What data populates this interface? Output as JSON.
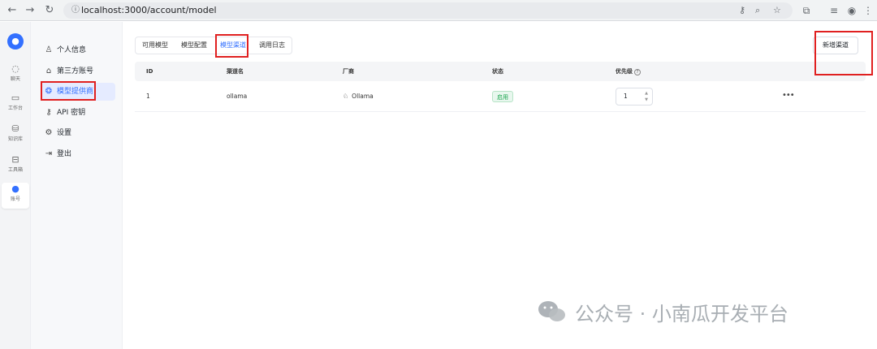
{
  "browser": {
    "url": "localhost:3000/account/model"
  },
  "rail": {
    "items": [
      {
        "icon": "chat-icon",
        "label": "聊天"
      },
      {
        "icon": "workbench-icon",
        "label": "工作台"
      },
      {
        "icon": "database-icon",
        "label": "知识库"
      },
      {
        "icon": "toolbox-icon",
        "label": "工具箱"
      },
      {
        "icon": "user-icon",
        "label": "账号"
      }
    ]
  },
  "sidebar": {
    "items": [
      {
        "icon": "user-icon",
        "label": "个人信息"
      },
      {
        "icon": "link-icon",
        "label": "第三方账号"
      },
      {
        "icon": "model-provider-icon",
        "label": "模型提供商"
      },
      {
        "icon": "key-icon",
        "label": "API 密钥"
      },
      {
        "icon": "gear-icon",
        "label": "设置"
      },
      {
        "icon": "logout-icon",
        "label": "登出"
      }
    ],
    "active_index": 2
  },
  "tabs": [
    {
      "label": "可用模型"
    },
    {
      "label": "模型配置"
    },
    {
      "label": "模型渠道"
    },
    {
      "label": "调用日志"
    }
  ],
  "active_tab": 2,
  "actions": {
    "add_channel_label": "新增渠道"
  },
  "table": {
    "columns": [
      "ID",
      "渠道名",
      "厂商",
      "状态",
      "优先级"
    ],
    "rows": [
      {
        "id": "1",
        "channel": "ollama",
        "vendor": "Ollama",
        "status": "启用",
        "priority": "1"
      }
    ]
  },
  "watermark": {
    "text": "公众号 · 小南瓜开发平台"
  },
  "colors": {
    "accent": "#3370ff",
    "highlight": "#e02020",
    "status_ok": "#16a34a"
  }
}
